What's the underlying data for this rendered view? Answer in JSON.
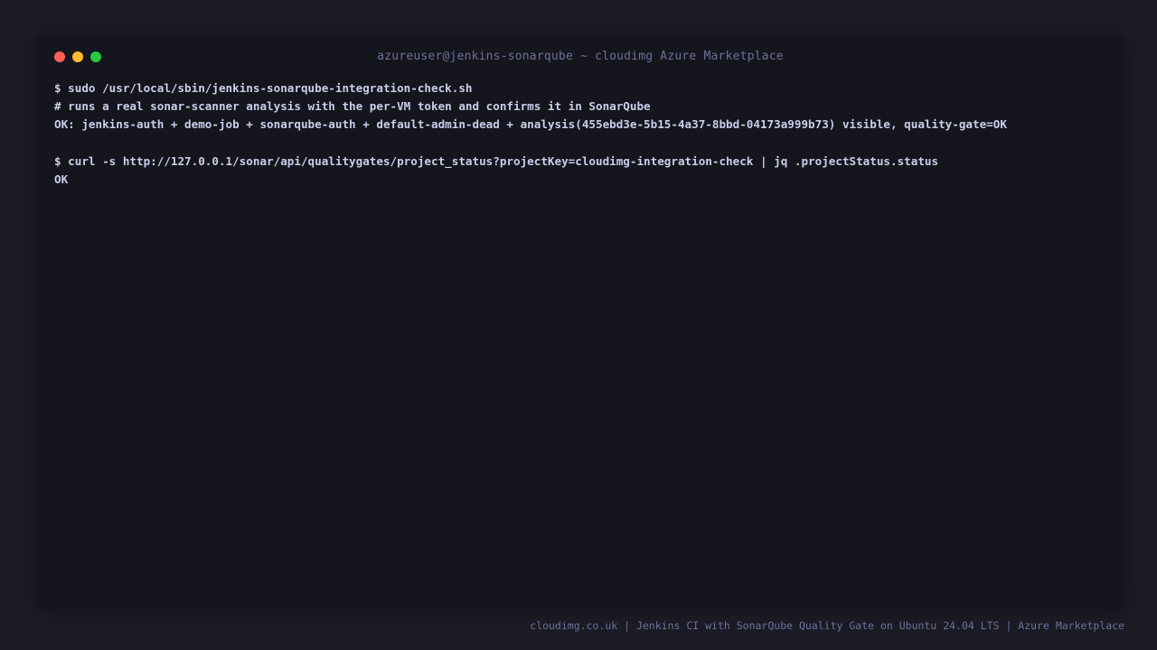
{
  "window": {
    "title": "azureuser@jenkins-sonarqube ~ cloudimg Azure Marketplace",
    "controls": {
      "close_color": "#ff5f57",
      "minimize_color": "#febc2e",
      "maximize_color": "#28c840"
    }
  },
  "terminal": {
    "lines": [
      "$ sudo /usr/local/sbin/jenkins-sonarqube-integration-check.sh",
      "# runs a real sonar-scanner analysis with the per-VM token and confirms it in SonarQube",
      "OK: jenkins-auth + demo-job + sonarqube-auth + default-admin-dead + analysis(455ebd3e-5b15-4a37-8bbd-04173a999b73) visible, quality-gate=OK",
      "",
      "$ curl -s http://127.0.0.1/sonar/api/qualitygates/project_status?projectKey=cloudimg-integration-check | jq .projectStatus.status",
      "OK"
    ]
  },
  "footer": {
    "text": "cloudimg.co.uk | Jenkins CI with SonarQube Quality Gate on Ubuntu 24.04 LTS | Azure Marketplace"
  }
}
